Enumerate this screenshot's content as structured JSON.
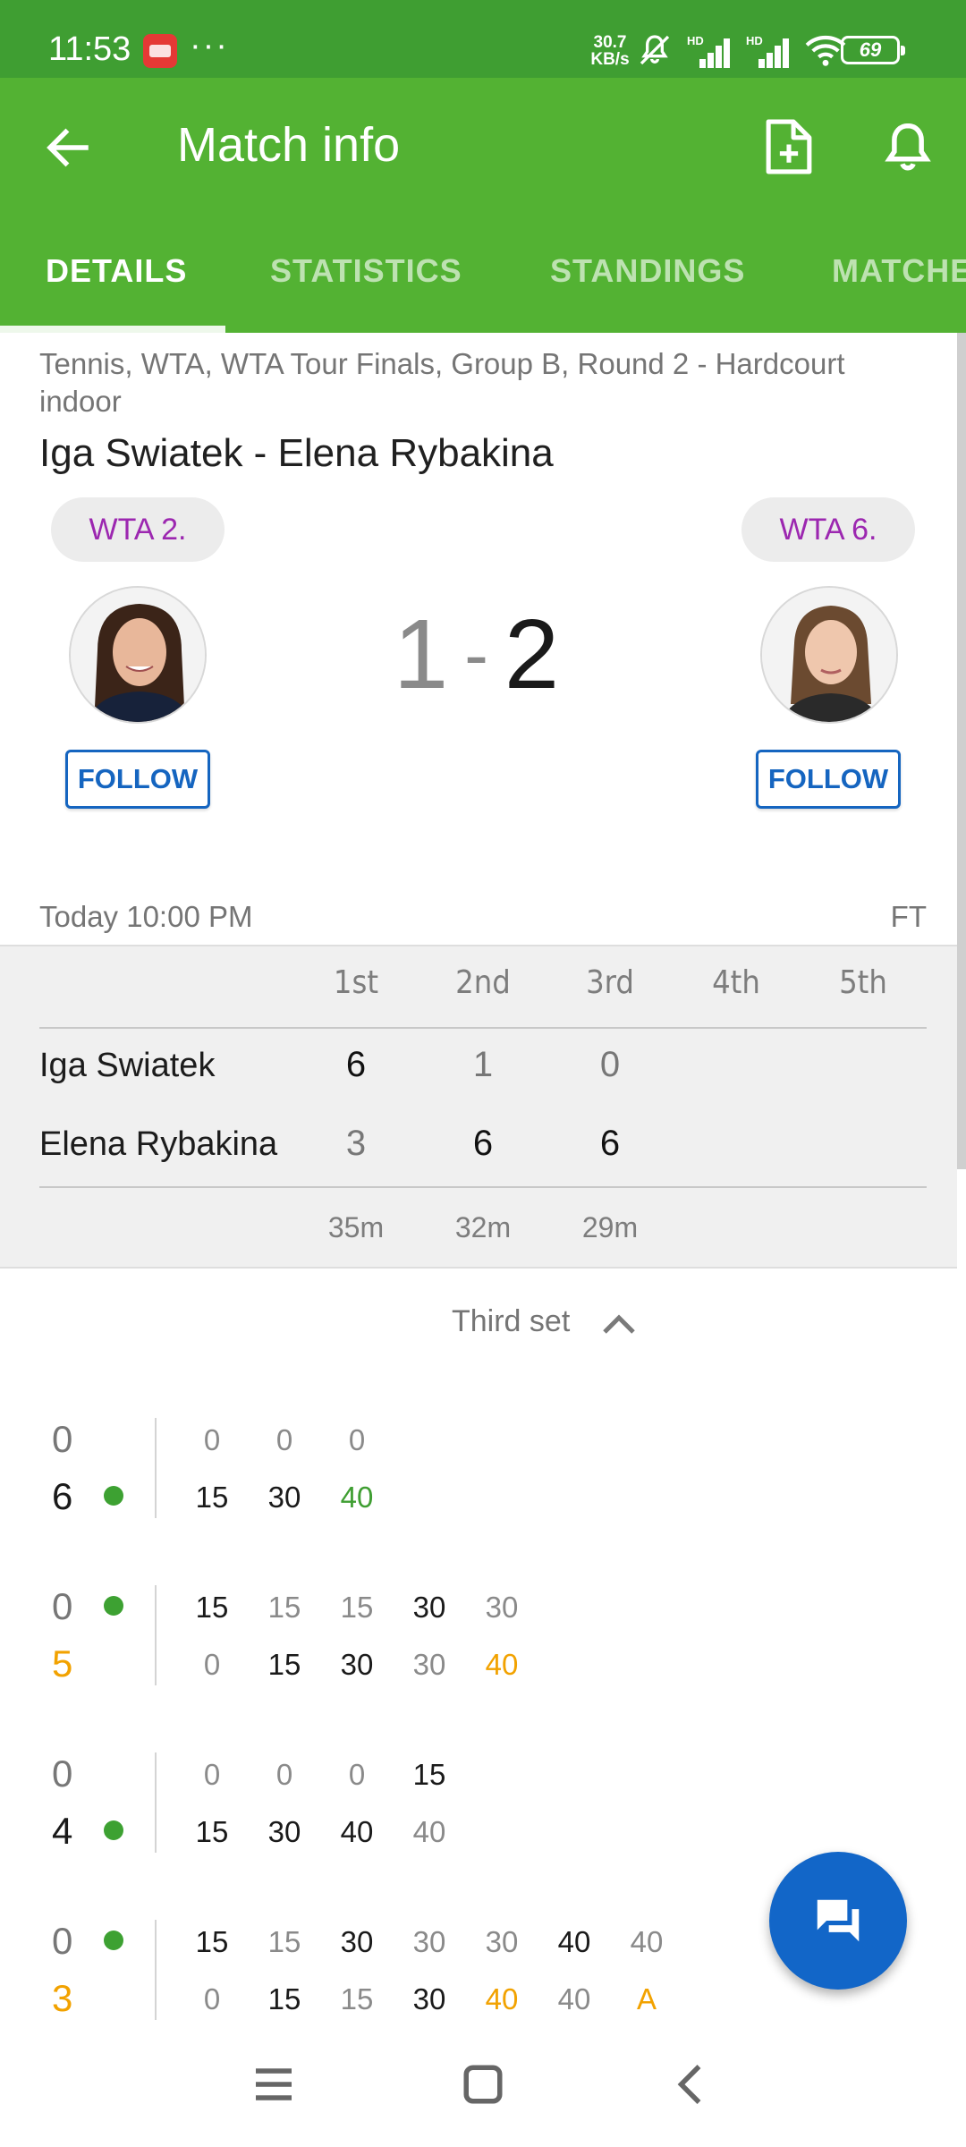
{
  "status_bar": {
    "time": "11:53",
    "more": "···",
    "net_speed_value": "30.7",
    "net_speed_unit": "KB/s",
    "signal_label": "HD",
    "battery": "69"
  },
  "app_bar": {
    "title": "Match info"
  },
  "tabs": [
    {
      "label": "DETAILS",
      "active": true
    },
    {
      "label": "STATISTICS",
      "active": false
    },
    {
      "label": "STANDINGS",
      "active": false
    },
    {
      "label": "MATCHES",
      "active": false
    }
  ],
  "match": {
    "breadcrumb": "Tennis, WTA, WTA Tour Finals, Group B, Round 2 - Hardcourt indoor",
    "title": "Iga Swiatek - Elena Rybakina",
    "home": {
      "name": "Iga Swiatek",
      "rank": "WTA 2.",
      "follow_label": "FOLLOW"
    },
    "away": {
      "name": "Elena Rybakina",
      "rank": "WTA 6.",
      "follow_label": "FOLLOW"
    },
    "score_home": "1",
    "score_sep": "-",
    "score_away": "2",
    "time": "Today 10:00 PM",
    "status": "FT"
  },
  "sets": {
    "headers": [
      "1st",
      "2nd",
      "3rd",
      "4th",
      "5th"
    ],
    "home": [
      "6",
      "1",
      "0",
      "",
      ""
    ],
    "away": [
      "3",
      "6",
      "6",
      "",
      ""
    ],
    "durations": [
      "35m",
      "32m",
      "29m",
      "",
      ""
    ]
  },
  "point_by_point": {
    "section_label": "Third set",
    "games": [
      {
        "home_games": "0",
        "away_games": "6",
        "server": "away",
        "home_points": [
          "0",
          "0",
          "0"
        ],
        "away_points": [
          "15",
          "30",
          "40"
        ]
      },
      {
        "home_games": "0",
        "away_games": "5",
        "server": "home",
        "home_points": [
          "15",
          "15",
          "15",
          "30",
          "30"
        ],
        "away_points": [
          "0",
          "15",
          "30",
          "30",
          "40"
        ]
      },
      {
        "home_games": "0",
        "away_games": "4",
        "server": "away",
        "home_points": [
          "0",
          "0",
          "0",
          "15"
        ],
        "away_points": [
          "15",
          "30",
          "40",
          "40"
        ]
      },
      {
        "home_games": "0",
        "away_games": "3",
        "server": "home",
        "home_points": [
          "15",
          "15",
          "30",
          "30",
          "30",
          "40",
          "40"
        ],
        "away_points": [
          "0",
          "15",
          "15",
          "30",
          "40",
          "40",
          "A"
        ]
      }
    ]
  },
  "colors": {
    "primary_green": "#53b233",
    "status_green": "#3f9e32",
    "follow_blue": "#1565c0",
    "fab_blue": "#1266c8",
    "rank_purple": "#9c27b0",
    "break_orange": "#f2a200"
  },
  "icons": [
    "back-arrow-icon",
    "add-document-icon",
    "bell-icon",
    "chevron-up-icon",
    "chat-icon",
    "menu-icon",
    "home-square-icon",
    "back-chevron-icon"
  ]
}
